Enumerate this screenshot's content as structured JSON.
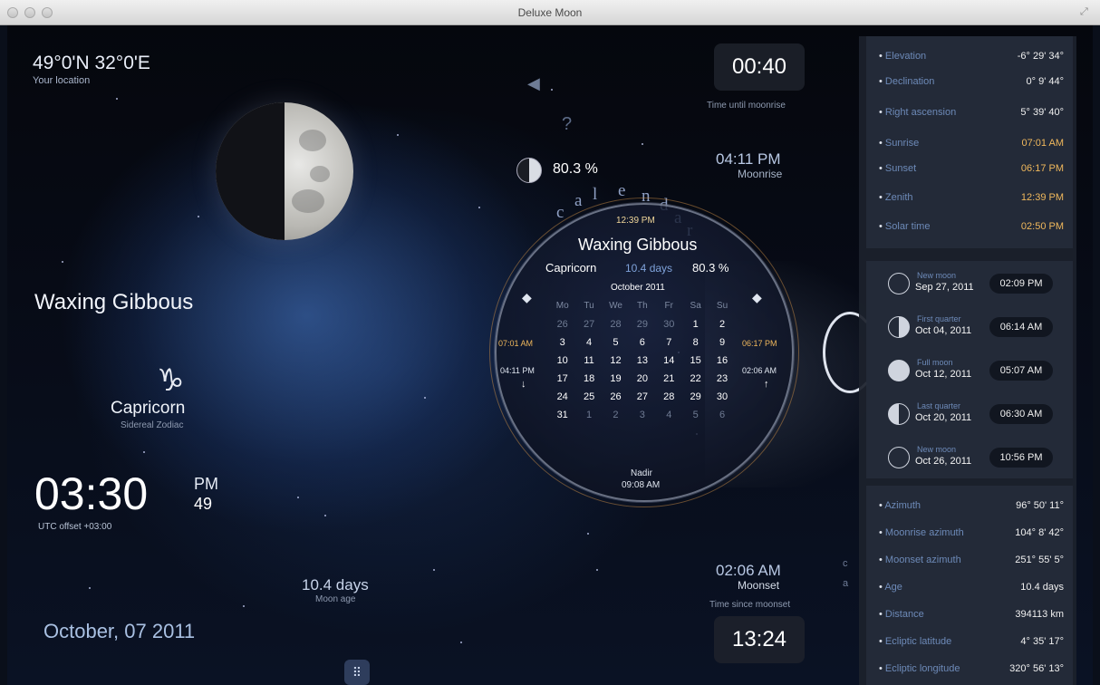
{
  "window": {
    "title": "Deluxe Moon"
  },
  "location": {
    "value": "49°0'N 32°0'E",
    "label": "Your location"
  },
  "phase": {
    "name": "Waxing Gibbous",
    "illumination": "80.3 %"
  },
  "zodiac": {
    "name": "Capricorn",
    "label": "Sidereal Zodiac",
    "icon": "capricorn-icon"
  },
  "clock": {
    "time": "03:30",
    "ampm": "PM",
    "seconds": "49",
    "utc_offset": "UTC offset +03:00"
  },
  "moon_age": {
    "value": "10.4 days",
    "label": "Moon age"
  },
  "date": "October, 07 2011",
  "moonrise": {
    "countdown": "00:40",
    "countdown_label": "Time until moonrise",
    "time": "04:11 PM",
    "label": "Moonrise"
  },
  "moonset": {
    "time": "02:06 AM",
    "label": "Moonset",
    "since_label": "Time since moonset",
    "elapsed": "13:24"
  },
  "calendar": {
    "title_letters": [
      "c",
      "a",
      "l",
      "e",
      "n",
      "d",
      "a",
      "r"
    ],
    "zenith": "12:39 PM",
    "phase": "Waxing Gibbous",
    "sign": "Capricorn",
    "days": "10.4 days",
    "pct": "80.3 %",
    "month": "October 2011",
    "weekdays": [
      "Mo",
      "Tu",
      "We",
      "Th",
      "Fr",
      "Sa",
      "Su"
    ],
    "weeks": [
      [
        "26",
        "27",
        "28",
        "29",
        "30",
        "1",
        "2"
      ],
      [
        "3",
        "4",
        "5",
        "6",
        "7",
        "8",
        "9"
      ],
      [
        "10",
        "11",
        "12",
        "13",
        "14",
        "15",
        "16"
      ],
      [
        "17",
        "18",
        "19",
        "20",
        "21",
        "22",
        "23"
      ],
      [
        "24",
        "25",
        "26",
        "27",
        "28",
        "29",
        "30"
      ],
      [
        "31",
        "1",
        "2",
        "3",
        "4",
        "5",
        "6"
      ]
    ],
    "sunrise_left": "07:01 AM",
    "sunset_right": "06:17 PM",
    "moonrise_left": "04:11 PM",
    "moonset_right": "02:06 AM",
    "nadir_label": "Nadir",
    "nadir_time": "09:08 AM"
  },
  "panel_sun": [
    {
      "key": "Elevation",
      "value": "-6° 29' 34°",
      "highlight": false
    },
    {
      "key": "Declination",
      "value": "0° 9' 44°",
      "highlight": false
    },
    {
      "key": "Right ascension",
      "value": "5° 39' 40°",
      "highlight": false
    },
    {
      "key": "Sunrise",
      "value": "07:01 AM",
      "highlight": true
    },
    {
      "key": "Sunset",
      "value": "06:17 PM",
      "highlight": true
    },
    {
      "key": "Zenith",
      "value": "12:39 PM",
      "highlight": true
    },
    {
      "key": "Solar time",
      "value": "02:50 PM",
      "highlight": true
    }
  ],
  "panel_phases": [
    {
      "name": "New moon",
      "date": "Sep 27, 2011",
      "time": "02:09 PM",
      "icon": "new-moon-icon"
    },
    {
      "name": "First quarter",
      "date": "Oct 04, 2011",
      "time": "06:14 AM",
      "icon": "first-quarter-icon"
    },
    {
      "name": "Full moon",
      "date": "Oct 12, 2011",
      "time": "05:07 AM",
      "icon": "full-moon-icon"
    },
    {
      "name": "Last quarter",
      "date": "Oct 20, 2011",
      "time": "06:30 AM",
      "icon": "last-quarter-icon"
    },
    {
      "name": "New moon",
      "date": "Oct 26, 2011",
      "time": "10:56 PM",
      "icon": "new-moon-icon"
    }
  ],
  "panel_moon": [
    {
      "key": "Azimuth",
      "value": "96° 50' 11°"
    },
    {
      "key": "Moonrise azimuth",
      "value": "104° 8' 42°"
    },
    {
      "key": "Moonset azimuth",
      "value": "251° 55' 5°"
    },
    {
      "key": "Age",
      "value": "10.4 days"
    },
    {
      "key": "Distance",
      "value": "394113 km"
    },
    {
      "key": "Ecliptic latitude",
      "value": "4° 35' 17°"
    },
    {
      "key": "Ecliptic longitude",
      "value": "320° 56' 13°"
    }
  ],
  "side": {
    "letter_c": "c",
    "letter_a": "a"
  },
  "icons": {
    "speaker": "speaker-icon",
    "help": "help-icon",
    "grid": "grid-icon"
  }
}
